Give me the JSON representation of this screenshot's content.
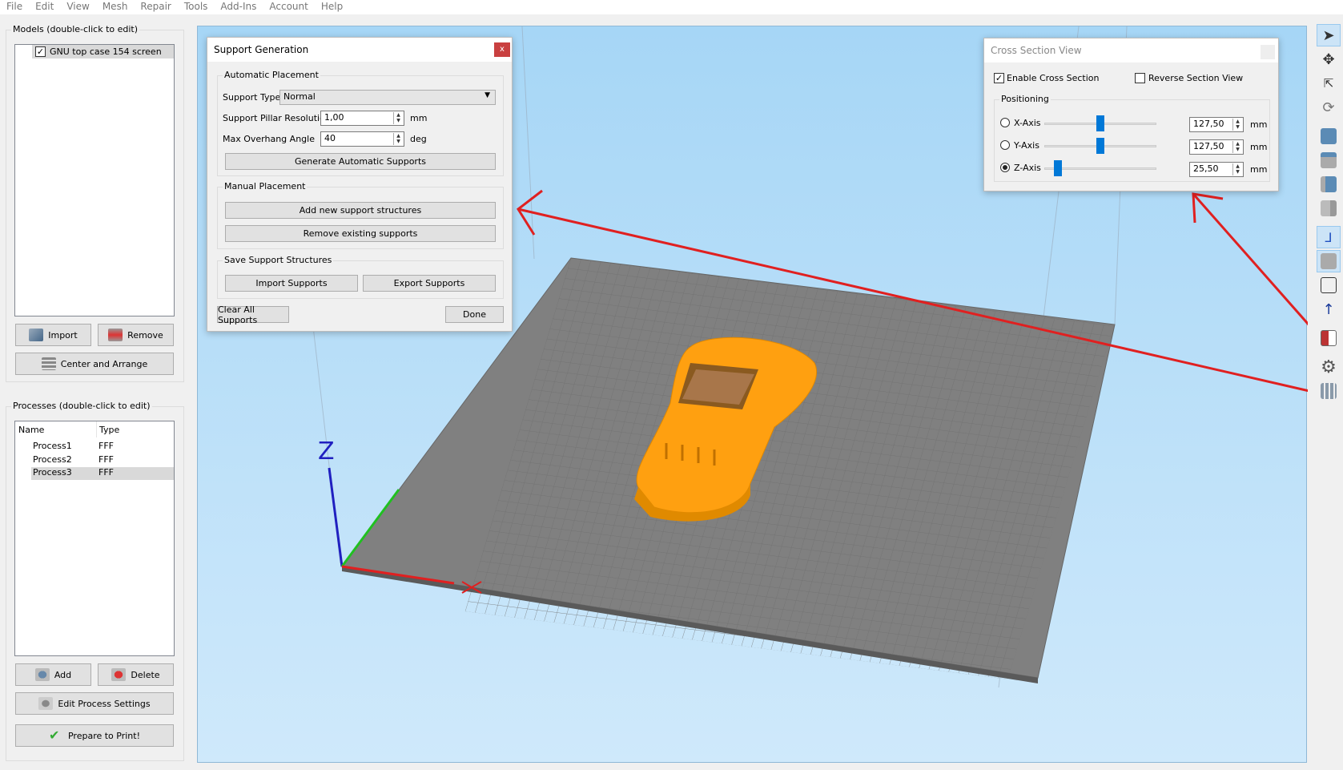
{
  "menu": [
    "File",
    "Edit",
    "View",
    "Mesh",
    "Repair",
    "Tools",
    "Add-Ins",
    "Account",
    "Help"
  ],
  "models": {
    "title": "Models (double-click to edit)",
    "items": [
      {
        "label": "GNU top case 154 screen",
        "checked": true
      }
    ],
    "import": "Import",
    "remove": "Remove",
    "center": "Center and Arrange"
  },
  "processes": {
    "title": "Processes (double-click to edit)",
    "columns": [
      "Name",
      "Type"
    ],
    "rows": [
      {
        "name": "Process1",
        "type": "FFF"
      },
      {
        "name": "Process2",
        "type": "FFF"
      },
      {
        "name": "Process3",
        "type": "FFF",
        "selected": true
      }
    ],
    "add": "Add",
    "delete": "Delete",
    "edit": "Edit Process Settings",
    "prepare": "Prepare to Print!"
  },
  "support": {
    "title": "Support Generation",
    "close": "x",
    "auto": {
      "title": "Automatic Placement",
      "type_label": "Support Type",
      "type_value": "Normal",
      "res_label": "Support Pillar Resolution",
      "res_value": "1,00",
      "res_unit": "mm",
      "angle_label": "Max Overhang Angle",
      "angle_value": "40",
      "angle_unit": "deg",
      "generate": "Generate Automatic Supports"
    },
    "manual": {
      "title": "Manual Placement",
      "add": "Add new support structures",
      "remove": "Remove existing supports"
    },
    "save": {
      "title": "Save Support Structures",
      "import": "Import Supports",
      "export": "Export Supports"
    },
    "clear": "Clear All Supports",
    "done": "Done"
  },
  "cross": {
    "title": "Cross Section View",
    "enable": "Enable Cross Section",
    "enable_checked": true,
    "reverse": "Reverse Section View",
    "reverse_checked": false,
    "positioning": "Positioning",
    "axes": [
      {
        "label": "X-Axis",
        "value": "127,50",
        "unit": "mm",
        "fraction": 0.5,
        "selected": false
      },
      {
        "label": "Y-Axis",
        "value": "127,50",
        "unit": "mm",
        "fraction": 0.5,
        "selected": false
      },
      {
        "label": "Z-Axis",
        "value": "25,50",
        "unit": "mm",
        "fraction": 0.12,
        "selected": true
      }
    ]
  },
  "viewport": {
    "z_label": "Z",
    "model_color": "#ffa010",
    "plate_color": "#808080",
    "annotation_color": "#e02020"
  },
  "toolbar": [
    "select-icon",
    "move-icon",
    "scale-icon",
    "rotate-icon",
    "view-front-icon",
    "view-top-icon",
    "view-side-icon",
    "view-back-icon",
    "axes-icon",
    "solid-view-icon",
    "wireframe-icon",
    "normals-icon",
    "cross-section-icon",
    "settings-icon",
    "supports-icon"
  ]
}
